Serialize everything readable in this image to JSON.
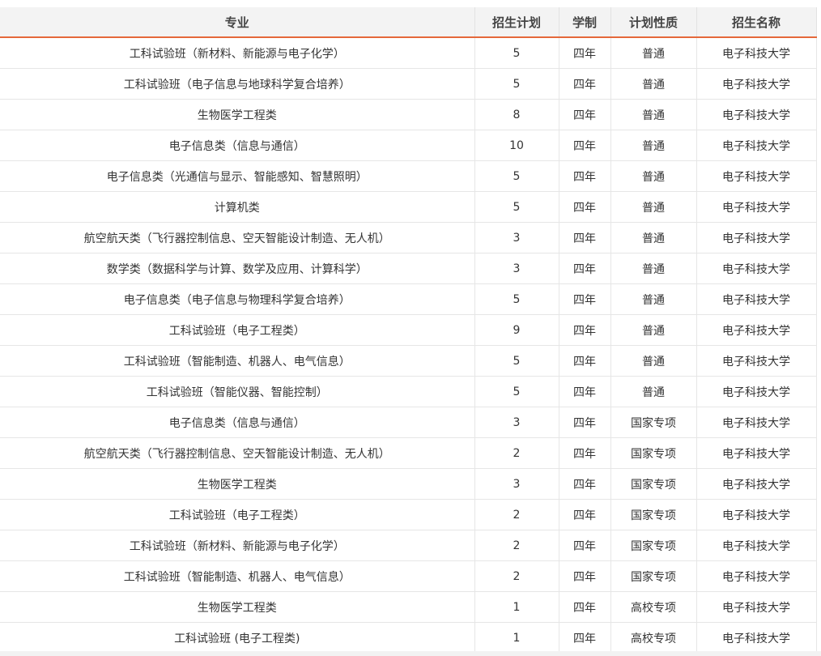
{
  "table": {
    "headers": {
      "major": "专业",
      "plan": "招生计划",
      "duration": "学制",
      "nature": "计划性质",
      "school": "招生名称"
    },
    "rows": [
      {
        "major": "工科试验班（新材料、新能源与电子化学）",
        "plan": "5",
        "duration": "四年",
        "nature": "普通",
        "school": "电子科技大学"
      },
      {
        "major": "工科试验班（电子信息与地球科学复合培养）",
        "plan": "5",
        "duration": "四年",
        "nature": "普通",
        "school": "电子科技大学"
      },
      {
        "major": "生物医学工程类",
        "plan": "8",
        "duration": "四年",
        "nature": "普通",
        "school": "电子科技大学"
      },
      {
        "major": "电子信息类（信息与通信）",
        "plan": "10",
        "duration": "四年",
        "nature": "普通",
        "school": "电子科技大学"
      },
      {
        "major": "电子信息类（光通信与显示、智能感知、智慧照明）",
        "plan": "5",
        "duration": "四年",
        "nature": "普通",
        "school": "电子科技大学"
      },
      {
        "major": "计算机类",
        "plan": "5",
        "duration": "四年",
        "nature": "普通",
        "school": "电子科技大学"
      },
      {
        "major": "航空航天类（飞行器控制信息、空天智能设计制造、无人机）",
        "plan": "3",
        "duration": "四年",
        "nature": "普通",
        "school": "电子科技大学"
      },
      {
        "major": "数学类（数据科学与计算、数学及应用、计算科学）",
        "plan": "3",
        "duration": "四年",
        "nature": "普通",
        "school": "电子科技大学"
      },
      {
        "major": "电子信息类（电子信息与物理科学复合培养）",
        "plan": "5",
        "duration": "四年",
        "nature": "普通",
        "school": "电子科技大学"
      },
      {
        "major": "工科试验班（电子工程类）",
        "plan": "9",
        "duration": "四年",
        "nature": "普通",
        "school": "电子科技大学"
      },
      {
        "major": "工科试验班（智能制造、机器人、电气信息）",
        "plan": "5",
        "duration": "四年",
        "nature": "普通",
        "school": "电子科技大学"
      },
      {
        "major": "工科试验班（智能仪器、智能控制）",
        "plan": "5",
        "duration": "四年",
        "nature": "普通",
        "school": "电子科技大学"
      },
      {
        "major": "电子信息类（信息与通信）",
        "plan": "3",
        "duration": "四年",
        "nature": "国家专项",
        "school": "电子科技大学"
      },
      {
        "major": "航空航天类（飞行器控制信息、空天智能设计制造、无人机）",
        "plan": "2",
        "duration": "四年",
        "nature": "国家专项",
        "school": "电子科技大学"
      },
      {
        "major": "生物医学工程类",
        "plan": "3",
        "duration": "四年",
        "nature": "国家专项",
        "school": "电子科技大学"
      },
      {
        "major": "工科试验班（电子工程类）",
        "plan": "2",
        "duration": "四年",
        "nature": "国家专项",
        "school": "电子科技大学"
      },
      {
        "major": "工科试验班（新材料、新能源与电子化学）",
        "plan": "2",
        "duration": "四年",
        "nature": "国家专项",
        "school": "电子科技大学"
      },
      {
        "major": "工科试验班（智能制造、机器人、电气信息）",
        "plan": "2",
        "duration": "四年",
        "nature": "国家专项",
        "school": "电子科技大学"
      },
      {
        "major": "生物医学工程类",
        "plan": "1",
        "duration": "四年",
        "nature": "高校专项",
        "school": "电子科技大学"
      },
      {
        "major": "工科试验班 (电子工程类)",
        "plan": "1",
        "duration": "四年",
        "nature": "高校专项",
        "school": "电子科技大学"
      }
    ]
  },
  "colors": {
    "header_underline": "#e5683a",
    "header_bg": "#f3f3f3",
    "grid": "#e6e6e6"
  }
}
